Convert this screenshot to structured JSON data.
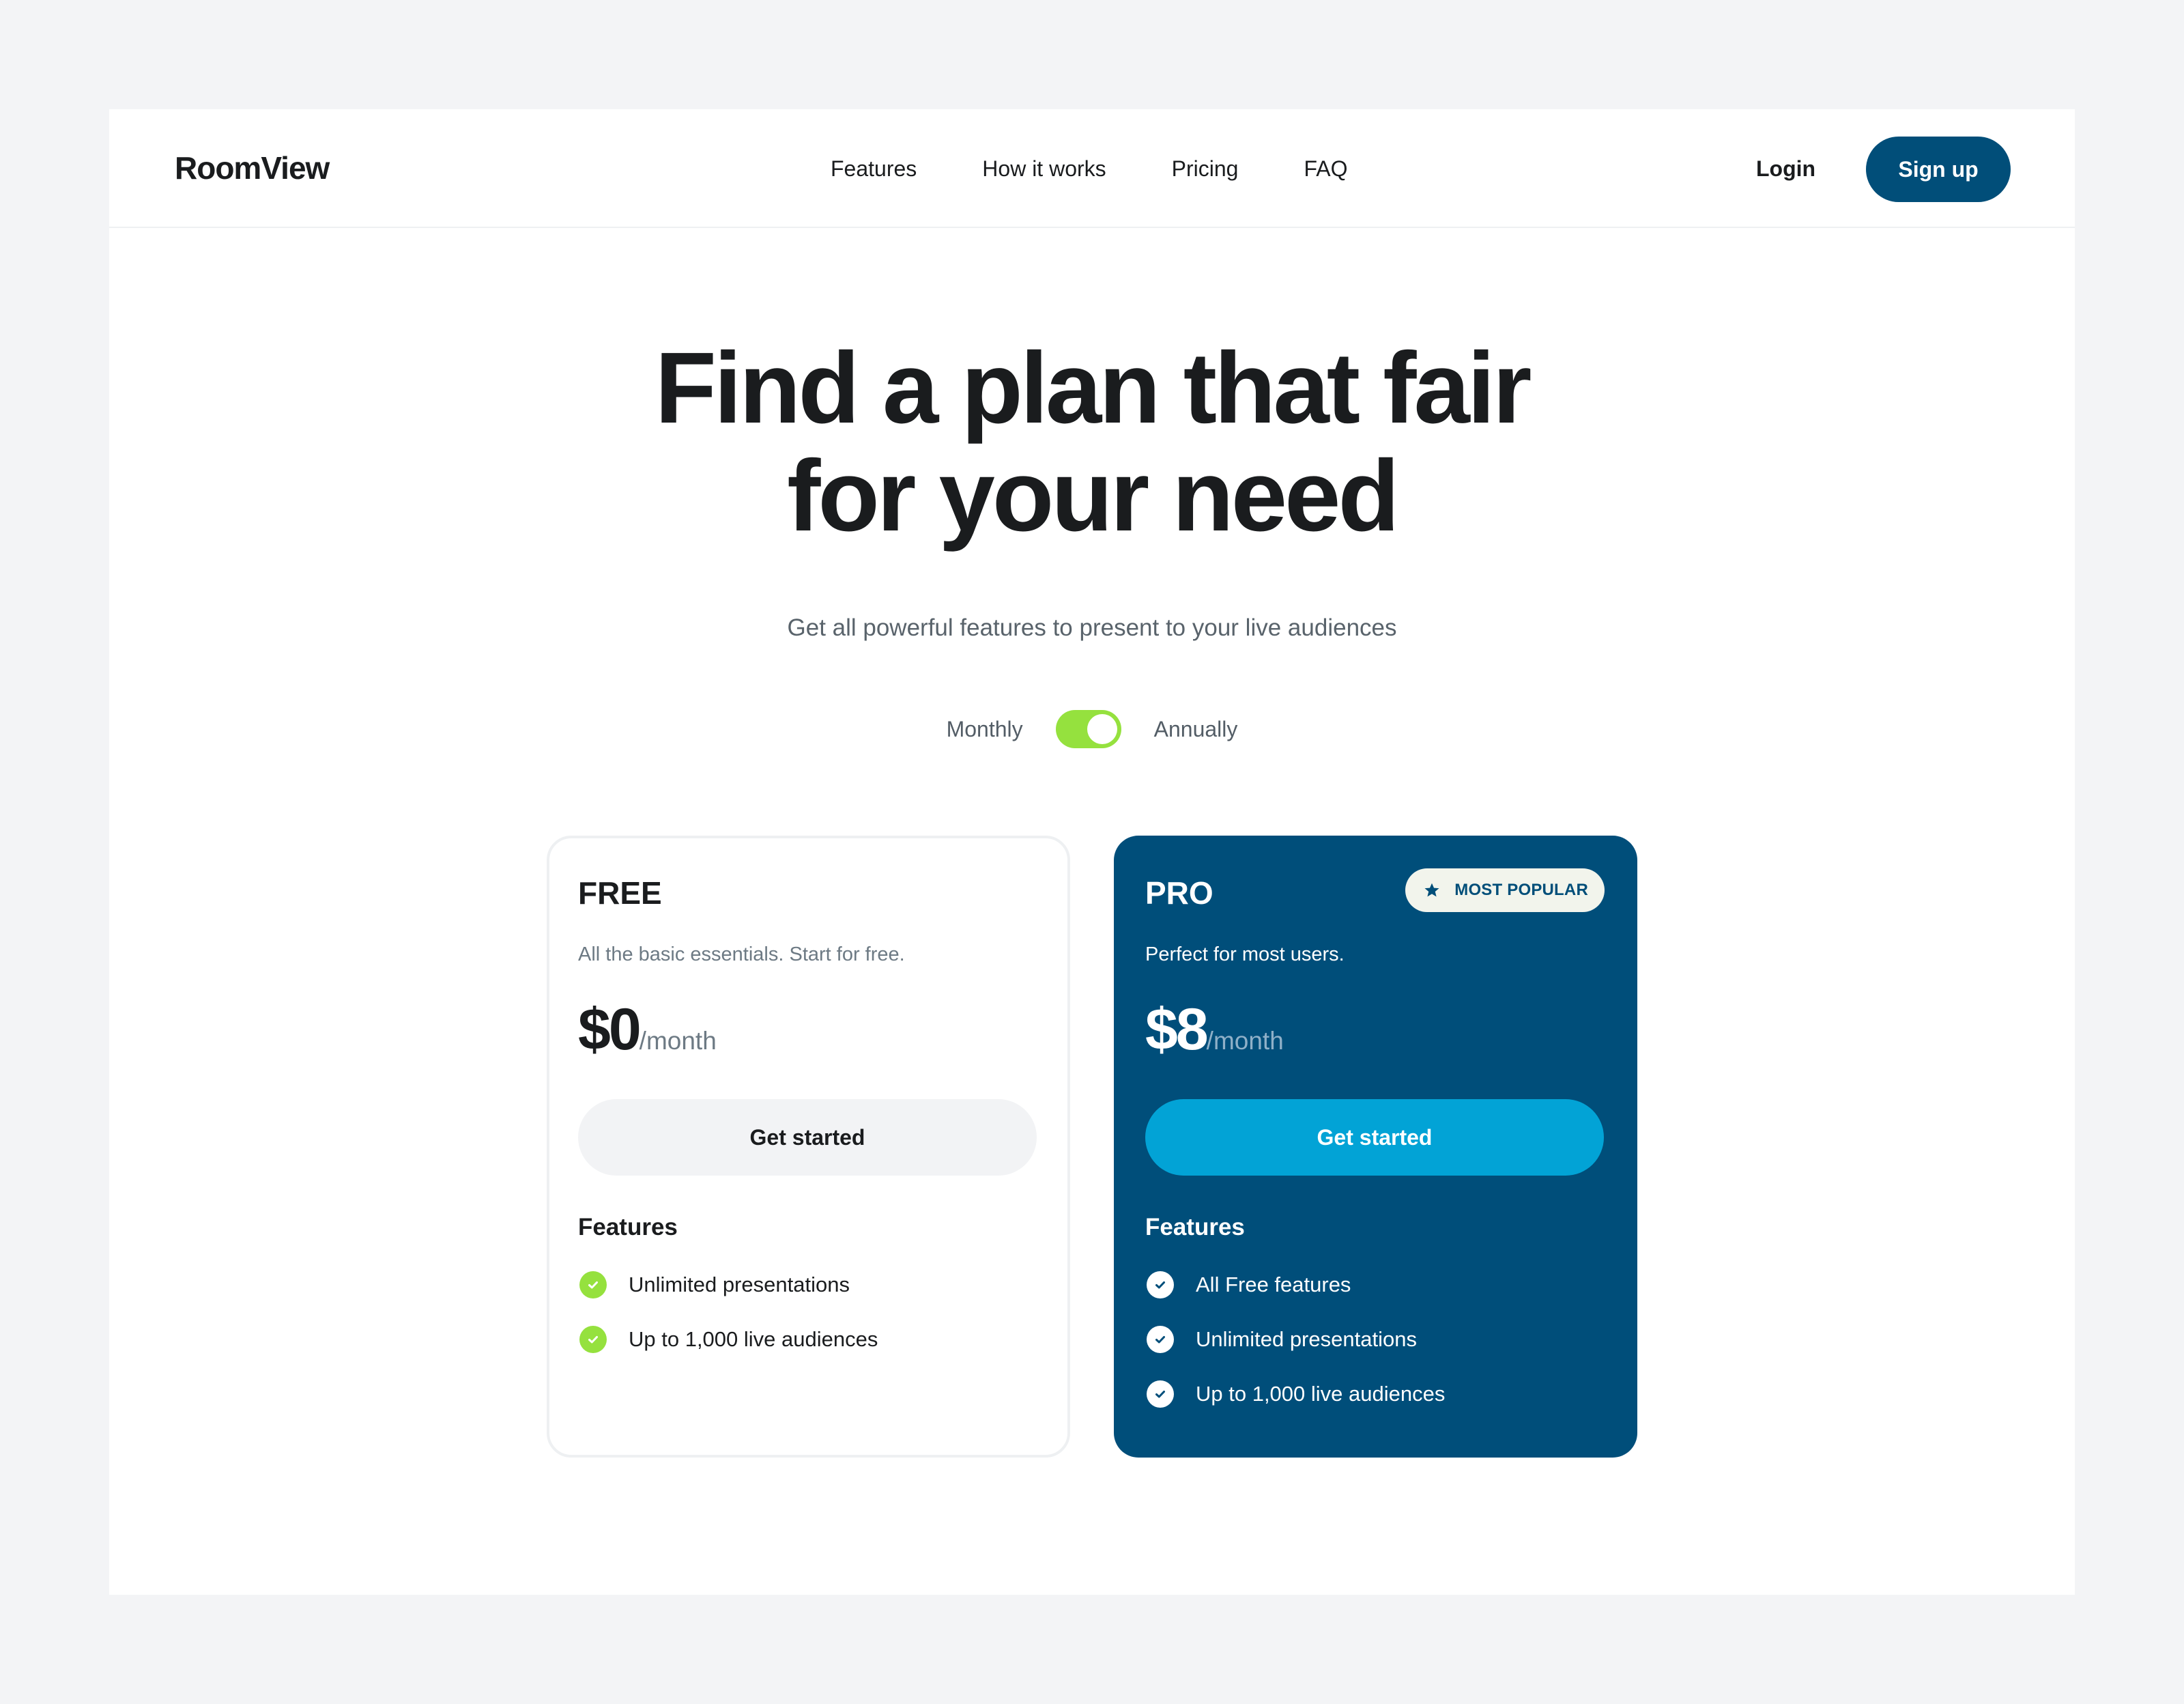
{
  "header": {
    "logo": "RoomView",
    "nav": [
      {
        "label": "Features"
      },
      {
        "label": "How it works"
      },
      {
        "label": "Pricing"
      },
      {
        "label": "FAQ"
      }
    ],
    "login_label": "Login",
    "signup_label": "Sign up"
  },
  "hero": {
    "title_line1": "Find a plan that fair",
    "title_line2": "for your need",
    "subtitle": "Get all powerful features to present to your live audiences"
  },
  "billing_toggle": {
    "left_label": "Monthly",
    "right_label": "Annually",
    "state": "on",
    "selected": "Annually"
  },
  "plans": [
    {
      "name": "FREE",
      "description": "All the basic essentials. Start for free.",
      "price": "$0",
      "period": "/month",
      "cta_label": "Get started",
      "features_title": "Features",
      "features": [
        "Unlimited presentations",
        "Up to 1,000 live audiences"
      ]
    },
    {
      "name": "PRO",
      "badge": {
        "icon": "star-icon",
        "label": "MOST POPULAR"
      },
      "description": "Perfect for most users.",
      "price": "$8",
      "period": "/month",
      "cta_label": "Get started",
      "features_title": "Features",
      "features": [
        "All Free features",
        "Unlimited presentations",
        "Up to 1,000 live audiences"
      ]
    }
  ],
  "colors": {
    "brand_navy": "#004E7A",
    "accent_blue": "#02A3D6",
    "accent_green": "#95E13E",
    "page_bg": "#F3F4F6",
    "text_dark": "#1A1C1E"
  }
}
